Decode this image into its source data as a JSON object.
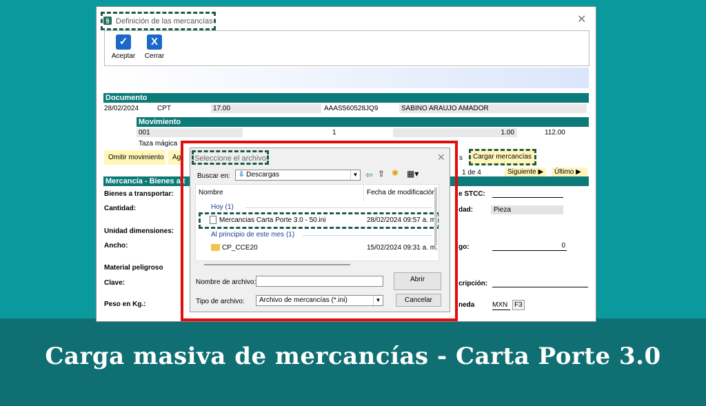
{
  "window": {
    "title": "Definición de las mercancías",
    "app_icon": "app-icon"
  },
  "toolbar": {
    "accept_label": "Aceptar",
    "close_label": "Cerrar"
  },
  "documento": {
    "header": "Documento",
    "fecha": "28/02/2024",
    "tipo": "CPT",
    "importe": "17.00",
    "rfc": "AAAS560528JQ9",
    "nombre": "SABINO ARAUJO AMADOR"
  },
  "movimiento": {
    "header": "Movimiento",
    "codigo": "001",
    "cantidad": "1",
    "precio": "1.00",
    "total": "112.00",
    "producto": "Taza mágica"
  },
  "actions": {
    "omitir": "Omitir movimiento",
    "ag": "Ag",
    "s": "s",
    "cargar": "Cargar mercancías",
    "page_info": "1 de 4",
    "siguiente": "Siguiente",
    "ultimo": "Último"
  },
  "mercancia": {
    "header": "Mercancía - Bienes a t",
    "bienes": "Bienes a transportar:",
    "cantidad": "Cantidad:",
    "unidad_dim": "Unidad dimensiones:",
    "ancho": "Ancho:",
    "material": "Material peligroso",
    "clave": "Clave:",
    "peso": "Peso en Kg.:",
    "stcc": "e STCC:",
    "dad": "dad:",
    "dad_value": "Pieza",
    "go": "go:",
    "go_value": "0",
    "descripcion": "cripción:",
    "moneda": "neda",
    "moneda_value": "MXN",
    "f3": "F3"
  },
  "dialog": {
    "title": "Seleccione el archivo",
    "buscar_label": "Buscar en:",
    "buscar_value": "Descargas",
    "col_nombre": "Nombre",
    "col_fecha": "Fecha de modificación",
    "group_hoy": "Hoy (1)",
    "file1_name": "Mercancias Carta Porte 3.0 - 50.ini",
    "file1_date": "28/02/2024 09:57 a. m.",
    "group_mes": "Al principio de este mes (1)",
    "folder1_name": "CP_CCE20",
    "folder1_date": "15/02/2024 09:31 a. m.",
    "nombre_archivo_label": "Nombre de archivo:",
    "nombre_archivo_value": "",
    "tipo_archivo_label": "Tipo de archivo:",
    "tipo_archivo_value": "Archivo de mercancías (*.ini)",
    "abrir": "Abrir",
    "cancelar": "Cancelar"
  },
  "banner": {
    "title": "Carga masiva de mercancías - Carta Porte 3.0"
  },
  "colors": {
    "background": "#0a9a9d",
    "banner": "#0f6f72",
    "section_header": "#0c7a78",
    "highlight_frame": "#e10c0c",
    "dashed_outline": "#1d5a4c",
    "toolbar_icon": "#1a68c8"
  }
}
